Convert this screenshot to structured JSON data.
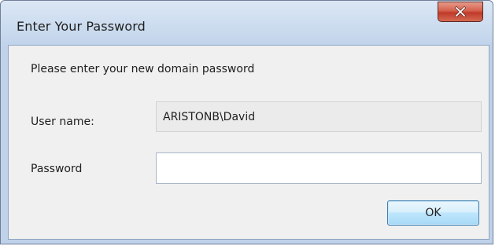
{
  "window": {
    "title": "Enter Your Password"
  },
  "titlebar": {
    "close_icon": "close-x-icon"
  },
  "dialog": {
    "instructions": "Please enter your new domain password",
    "username_label": "User name:",
    "username_value": "ARISTONB\\David",
    "password_label": "Password",
    "password_value": "",
    "ok_label": "OK"
  },
  "colors": {
    "close_button_red": "#c7402b",
    "titlebar_blue": "#c9daee",
    "client_background": "#f0f0f0",
    "ok_button_accent": "#3c7fb1"
  }
}
